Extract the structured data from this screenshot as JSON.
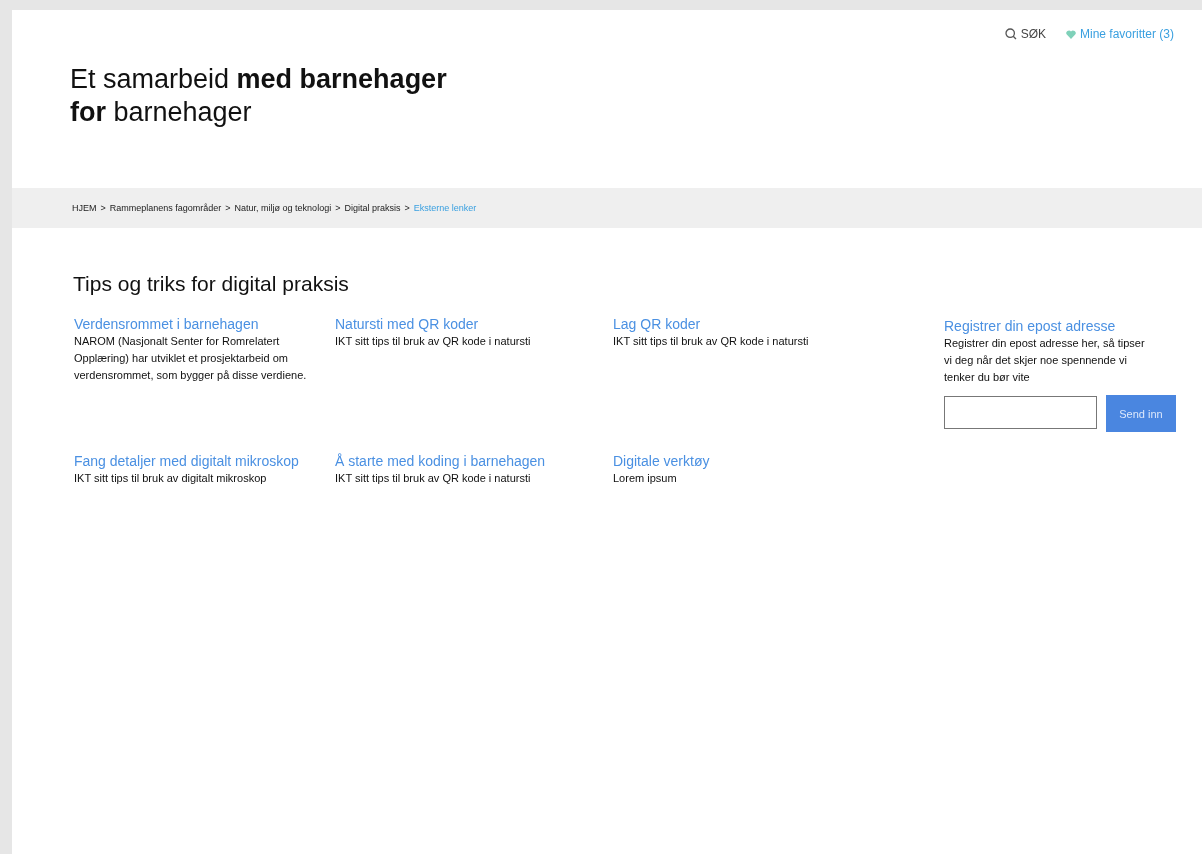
{
  "utility_nav": {
    "search": {
      "label": "SØK"
    },
    "favorites": {
      "label": "Mine favoritter (3)"
    }
  },
  "hero": {
    "title_lines": [
      "Et samarbeid **med barnehager**",
      "**for** barnehager"
    ]
  },
  "breadcrumb": [
    {
      "label": "HJEM",
      "separator": ">",
      "kind": "link"
    },
    {
      "label": "Rammeplanens fagområder",
      "separator": ">",
      "kind": "link"
    },
    {
      "label": "Natur, miljø og teknologi",
      "separator": ">",
      "kind": "link"
    },
    {
      "label": "Digital praksis",
      "separator": ">",
      "kind": "link"
    },
    {
      "label": "Eksterne lenker",
      "kind": "current"
    }
  ],
  "section": {
    "heading": "Tips og triks for digital praksis",
    "cards": [
      {
        "title": "Verdensrommet i barnehagen",
        "text": "NAROM (Nasjonalt Senter for Romrelatert Opplæring) har utviklet et prosjektarbeid om verdensrommet, som bygger på disse verdiene."
      },
      {
        "title": "Natursti med QR koder",
        "text": "IKT sitt tips til bruk av QR kode i natursti"
      },
      {
        "title": "Lag QR koder",
        "text": "IKT sitt tips til bruk av QR kode i natursti"
      },
      {
        "title": "Fang detaljer med digitalt mikroskop",
        "text": "IKT sitt tips til bruk av digitalt mikroskop"
      },
      {
        "title": "Å starte med koding i barnehagen",
        "text": "IKT sitt tips til bruk av QR kode i natursti"
      },
      {
        "title": "Digitale verktøy",
        "text": "Lorem ipsum"
      }
    ]
  },
  "signup": {
    "title": "Registrer din epost adresse",
    "text": "Registrer din epost adresse her, så tipser vi deg når det skjer noe spennende vi tenker du bør vite",
    "button": "Send inn"
  }
}
